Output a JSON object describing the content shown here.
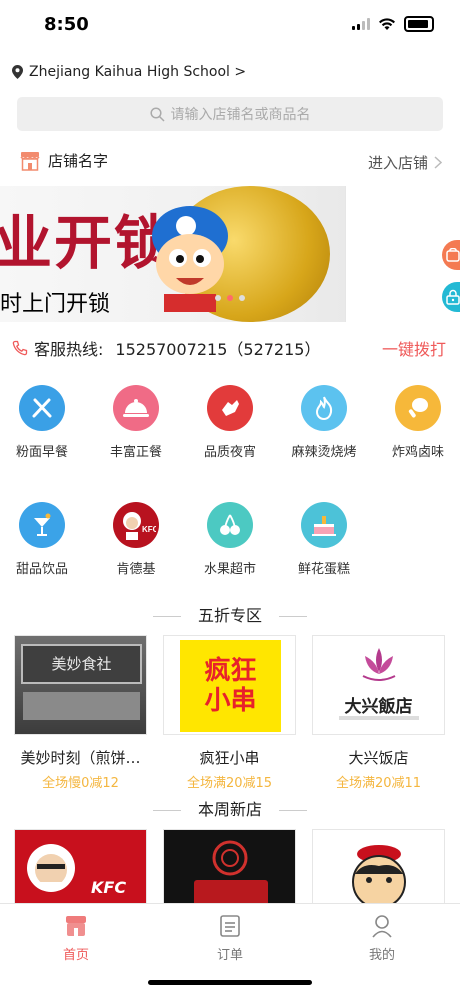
{
  "status": {
    "time": "8:50"
  },
  "location": {
    "text": "Zhejiang Kaihua High School >"
  },
  "search": {
    "placeholder": "请输入店铺名或商品名"
  },
  "shop": {
    "name": "店铺名字",
    "enter": "进入店铺"
  },
  "banner": {
    "headline": "业开锁",
    "subline": "时上门开锁"
  },
  "hotline": {
    "label": "客服热线:",
    "number": "15257007215（527215）",
    "dial": "一键拨打"
  },
  "categories": [
    {
      "label": "粉面早餐",
      "icon": "fork-knife-icon",
      "color": "#3aa0e6"
    },
    {
      "label": "丰富正餐",
      "icon": "cloche-icon",
      "color": "#f06b86"
    },
    {
      "label": "品质夜宵",
      "icon": "hand-icon",
      "color": "#e23b3b"
    },
    {
      "label": "麻辣烫烧烤",
      "icon": "flame-icon",
      "color": "#5cc2ef"
    },
    {
      "label": "炸鸡卤味",
      "icon": "drumstick-icon",
      "color": "#f6b83a"
    },
    {
      "label": "甜品饮品",
      "icon": "drink-icon",
      "color": "#3ba3e8"
    },
    {
      "label": "肯德基",
      "icon": "kfc-icon",
      "color": "#b8121f"
    },
    {
      "label": "水果超市",
      "icon": "cherry-icon",
      "color": "#4cc9c2"
    },
    {
      "label": "鲜花蛋糕",
      "icon": "cake-icon",
      "color": "#4cc2d8"
    }
  ],
  "half_price": {
    "title": "五折专区",
    "shops": [
      {
        "name": "美妙时刻（煎饼…",
        "promo": "全场慢0减12",
        "sign": "美妙食社"
      },
      {
        "name": "疯狂小串",
        "promo": "全场满20减15",
        "sign": "疯狂小串"
      },
      {
        "name": "大兴饭店",
        "promo": "全场满20减11",
        "sign": "大兴飯店"
      }
    ]
  },
  "new_shops": {
    "title": "本周新店",
    "shops": [
      {
        "sign": "KFC"
      },
      {
        "sign": ""
      },
      {
        "sign": ""
      }
    ]
  },
  "tabbar": {
    "home": "首页",
    "orders": "订单",
    "mine": "我的"
  },
  "colors": {
    "accent": "#ef5a5a",
    "promo": "#f4b63f"
  }
}
